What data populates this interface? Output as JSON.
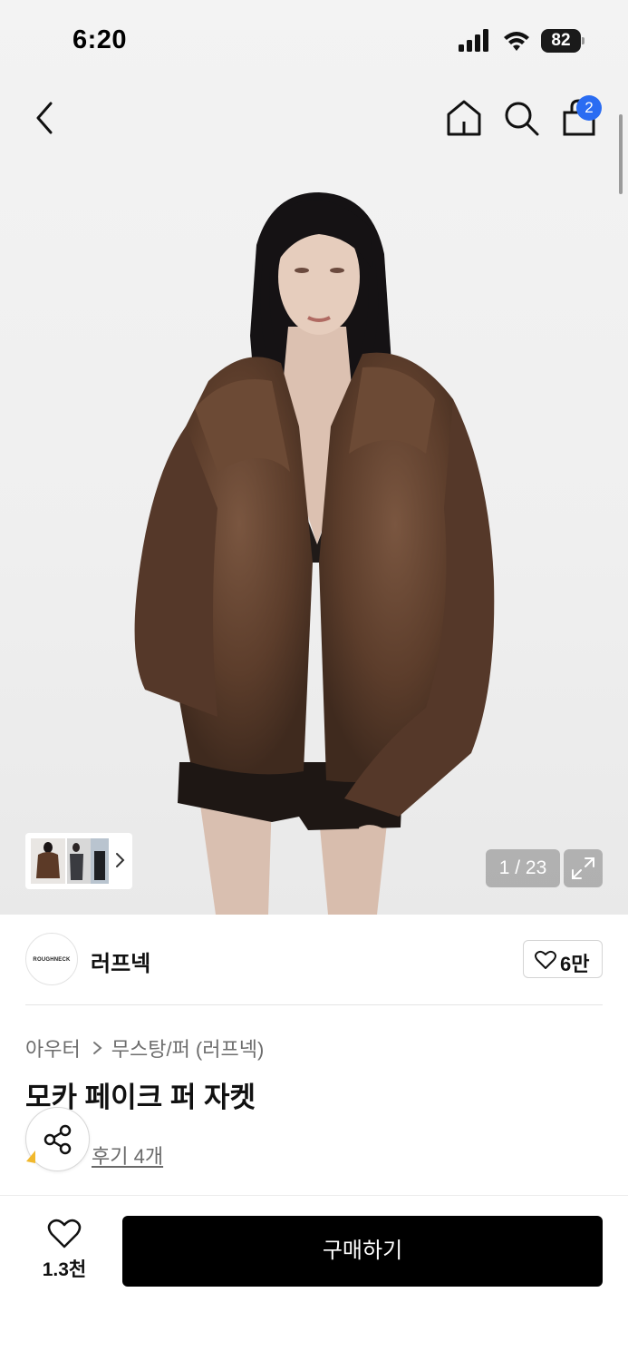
{
  "status_bar": {
    "time": "6:20",
    "battery": "82"
  },
  "nav": {
    "cart_count": "2"
  },
  "gallery": {
    "page_counter": "1 / 23"
  },
  "brand": {
    "logo_text": "ROUGHNECK",
    "name": "러프넥",
    "like_count": "6만"
  },
  "breadcrumb": {
    "items": [
      "아우터",
      "무스탕/퍼 (러프넥)"
    ]
  },
  "product": {
    "title": "모카 페이크 퍼 자켓",
    "review_link": "후기 4개"
  },
  "bottom_bar": {
    "wish_count": "1.3천",
    "buy_label": "구매하기"
  },
  "colors": {
    "accent_badge": "#2a6cf2",
    "buy_button": "#000000",
    "fur": "#5a3b29"
  }
}
